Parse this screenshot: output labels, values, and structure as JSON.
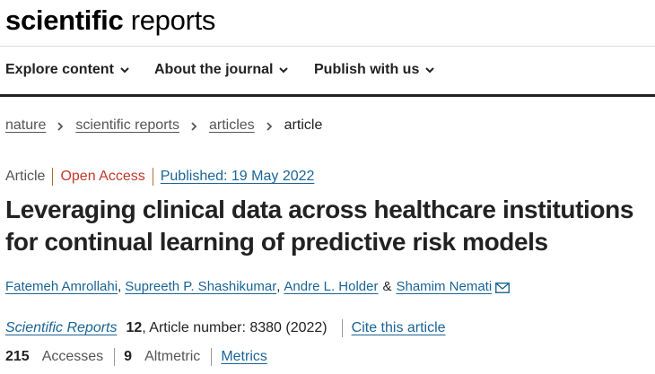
{
  "header": {
    "logo_bold": "scientific",
    "logo_light": "reports"
  },
  "nav": {
    "items": [
      {
        "label": "Explore content"
      },
      {
        "label": "About the journal"
      },
      {
        "label": "Publish with us"
      }
    ]
  },
  "breadcrumb": {
    "items": [
      "nature",
      "scientific reports",
      "articles"
    ],
    "current": "article"
  },
  "article": {
    "type": "Article",
    "access": "Open Access",
    "published": "Published: 19 May 2022",
    "title": "Leveraging clinical data across healthcare institutions for continual learning of predictive risk models",
    "authors": [
      "Fatemeh Amrollahi",
      "Supreeth P. Shashikumar",
      "Andre L. Holder",
      "Shamim Nemati"
    ],
    "author_sep_1": ",",
    "author_sep_2": ",",
    "author_sep_3": "&",
    "journal": "Scientific Reports",
    "volume": "12",
    "article_number": ", Article number: 8380 (2022)",
    "cite_label": "Cite this article",
    "accesses_count": "215",
    "accesses_label": "Accesses",
    "altmetric_count": "9",
    "altmetric_label": "Altmetric",
    "metrics_label": "Metrics"
  },
  "colors": {
    "link": "#1a6496",
    "open_access": "#c0392b",
    "divider_accent": "#b86b2e"
  },
  "icons": {
    "nav_chevron": "chevron-down-icon",
    "breadcrumb_sep": "chevron-right-icon",
    "corresponding_author": "mail-icon"
  }
}
